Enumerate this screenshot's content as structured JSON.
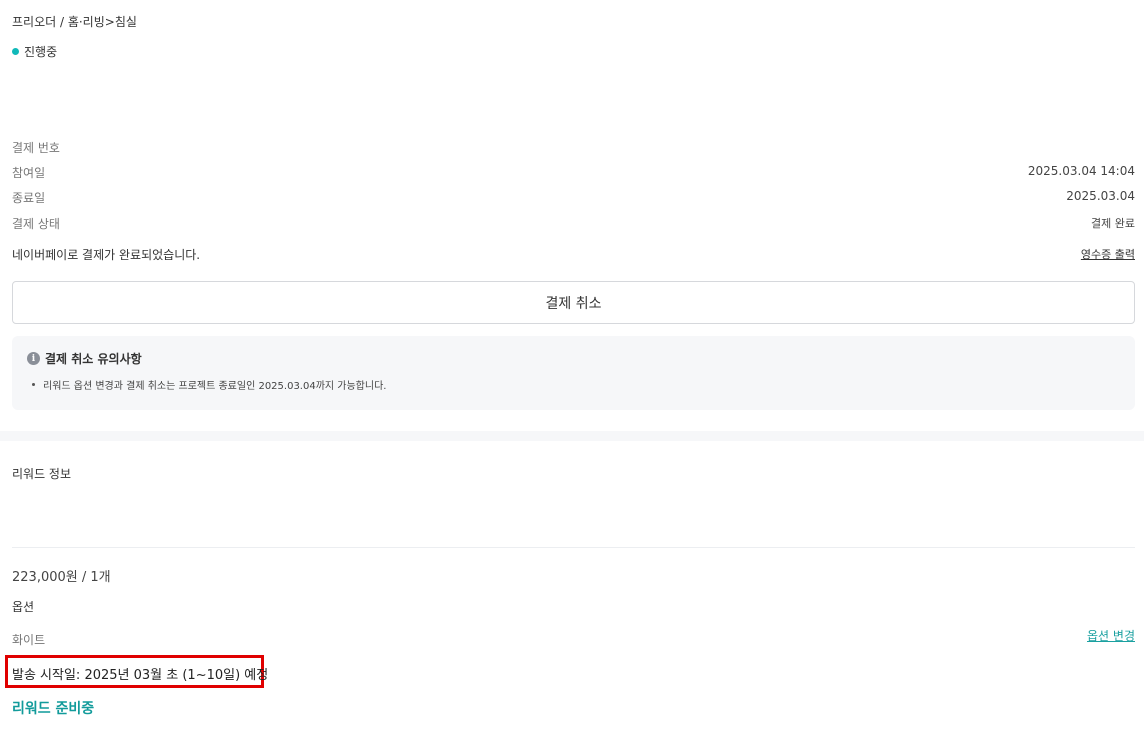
{
  "breadcrumb": "프리오더 / 홈·리빙>침실",
  "status": {
    "label": "진행중",
    "color": "#10b9b9"
  },
  "payment": {
    "rows": [
      {
        "label": "결제 번호",
        "value": ""
      },
      {
        "label": "참여일",
        "value": "2025.03.04 14:04"
      },
      {
        "label": "종료일",
        "value": "2025.03.04"
      },
      {
        "label": "결제 상태",
        "value": "결제 완료"
      }
    ],
    "message": "네이버페이로 결제가 완료되었습니다.",
    "receipt_link": "영수증 출력",
    "cancel_button": "결제 취소"
  },
  "notice": {
    "icon": "info-icon",
    "title": "결제 취소 유의사항",
    "items": [
      "리워드 옵션 변경과 결제 취소는 프로젝트 종료일인 2025.03.04까지 가능합니다."
    ]
  },
  "reward": {
    "title": "리워드 정보",
    "price": "223,000원 / 1개",
    "option_title": "옵션",
    "option_value": "화이트",
    "option_change_link": "옵션 변경",
    "ship_date": "발송 시작일: 2025년 03월 초 (1~10일) 예정",
    "status": "리워드 준비중"
  },
  "colors": {
    "accent": "#129b9b",
    "highlight_border": "#e00000"
  }
}
